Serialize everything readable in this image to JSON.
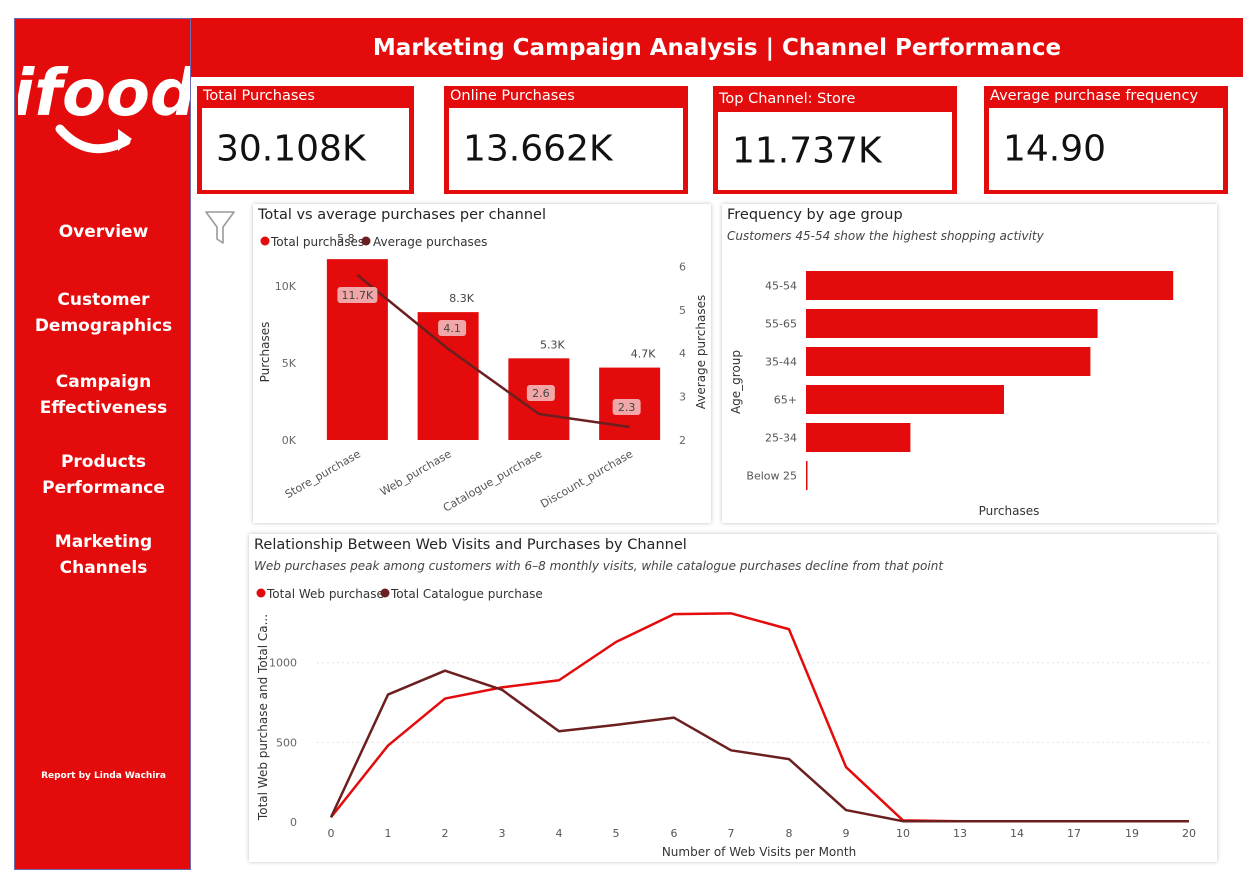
{
  "header": {
    "title": "Marketing Campaign Analysis | Channel Performance"
  },
  "sidebar": {
    "logo_text": "ifood",
    "items": [
      {
        "label_lines": [
          "Overview"
        ]
      },
      {
        "label_lines": [
          "Customer",
          "Demographics"
        ]
      },
      {
        "label_lines": [
          "Campaign",
          "Effectiveness"
        ]
      },
      {
        "label_lines": [
          "Products",
          "Performance"
        ]
      },
      {
        "label_lines": [
          "Marketing",
          "Channels"
        ]
      }
    ],
    "credit": "Report by Linda Wachira"
  },
  "kpis": [
    {
      "label": "Total Purchases",
      "value": "30.108K"
    },
    {
      "label": "Online Purchases",
      "value": "13.662K"
    },
    {
      "label": "Top Channel: Store",
      "value": "11.737K"
    },
    {
      "label": "Average purchase frequency",
      "value": "14.90"
    }
  ],
  "colors": {
    "brand": "#e30b0b",
    "dark": "#6b1f1f",
    "white": "#ffffff"
  },
  "icons": {
    "filter": "filter-icon"
  },
  "chart_data": [
    {
      "type": "bar",
      "title": "Total vs average purchases per channel",
      "categories": [
        "Store_purchase",
        "Web_purchase",
        "Catalogue_purchase",
        "Discount_purchase"
      ],
      "series": [
        {
          "name": "Total purchases",
          "values": [
            11737,
            8300,
            5300,
            4700
          ],
          "data_labels": [
            "11.7K",
            "8.3K",
            "5.3K",
            "4.7K"
          ],
          "color": "#e30b0b"
        },
        {
          "name": "Average purchases",
          "type": "line",
          "axis": "secondary",
          "values": [
            5.8,
            4.1,
            2.6,
            2.3
          ],
          "data_labels": [
            "5.8",
            "4.1",
            "2.6",
            "2.3"
          ],
          "color": "#6b1f1f"
        }
      ],
      "ylabel": "Purchases",
      "y2label": "Average purchases",
      "ylim": [
        0,
        13500
      ],
      "y2lim": [
        2,
        6.1
      ],
      "yticks": [
        0,
        5000,
        10000
      ],
      "ytick_labels": [
        "0K",
        "5K",
        "10K"
      ],
      "y2ticks": [
        2,
        3,
        4,
        5,
        6
      ],
      "y2tick_labels": [
        "2",
        "3",
        "4",
        "5",
        "6"
      ],
      "legend": "top-left"
    },
    {
      "type": "bar",
      "orientation": "horizontal",
      "title": "Frequency by age group",
      "subtitle": "Customers 45-54 show the highest shopping activity",
      "categories": [
        "45-54",
        "55-65",
        "35-44",
        "65+",
        "25-34",
        "Below 25"
      ],
      "values": [
        10200,
        8100,
        7900,
        5500,
        2900,
        30
      ],
      "xlabel": "Purchases",
      "ylabel": "Age_group",
      "xlim": [
        0,
        11000
      ],
      "color": "#e30b0b"
    },
    {
      "type": "line",
      "title": "Relationship Between Web Visits and Purchases by Channel",
      "subtitle": "Web purchases peak among customers with 6–8 monthly visits, while catalogue purchases decline from that point",
      "x": [
        0,
        1,
        2,
        3,
        4,
        5,
        6,
        7,
        8,
        9,
        10,
        13,
        14,
        17,
        19,
        20
      ],
      "series": [
        {
          "name": "Total Web purchase",
          "values": [
            30,
            480,
            775,
            845,
            890,
            1130,
            1305,
            1310,
            1210,
            345,
            10,
            5,
            5,
            5,
            5,
            5
          ],
          "color": "#e30b0b"
        },
        {
          "name": "Total Catalogue purchase",
          "values": [
            30,
            800,
            950,
            830,
            570,
            610,
            655,
            450,
            395,
            75,
            5,
            5,
            5,
            5,
            5,
            5
          ],
          "color": "#6b1f1f"
        }
      ],
      "xlabel": "Number of Web Visits per Month",
      "ylabel": "Total Web purchase and Total Ca...",
      "ylim": [
        0,
        1400
      ],
      "yticks": [
        0,
        500,
        1000
      ],
      "ytick_labels": [
        "0",
        "500",
        "1000"
      ],
      "legend": "top-left",
      "grid": true
    }
  ]
}
